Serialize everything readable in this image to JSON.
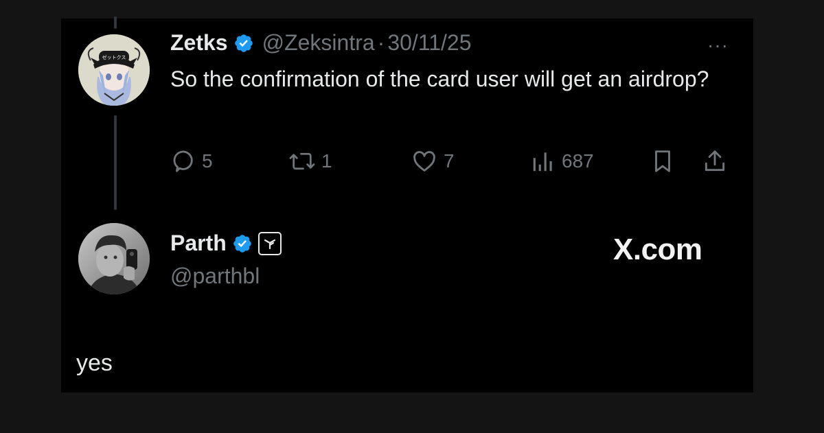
{
  "original_tweet": {
    "author_name": "Zetks",
    "handle": "@Zeksintra",
    "separator": "·",
    "date": "30/11/25",
    "text": "So the confirmation of the card user will get an airdrop?",
    "more_label": "···",
    "avatar_badge_text": "ゼットクス",
    "metrics": {
      "replies": "5",
      "reposts": "1",
      "likes": "7",
      "views": "687"
    },
    "icons": [
      "reply-icon",
      "repost-icon",
      "like-icon",
      "views-icon",
      "bookmark-icon",
      "share-icon"
    ]
  },
  "reply_tweet": {
    "author_name": "Parth",
    "handle": "@parthbl",
    "text": "yes",
    "watermark": "X.com"
  },
  "colors": {
    "background": "#000000",
    "frame": "#141414",
    "text_primary": "#e7e9ea",
    "text_secondary": "#71767b",
    "verified_blue": "#1d9bf0",
    "thread_line": "#333639"
  }
}
